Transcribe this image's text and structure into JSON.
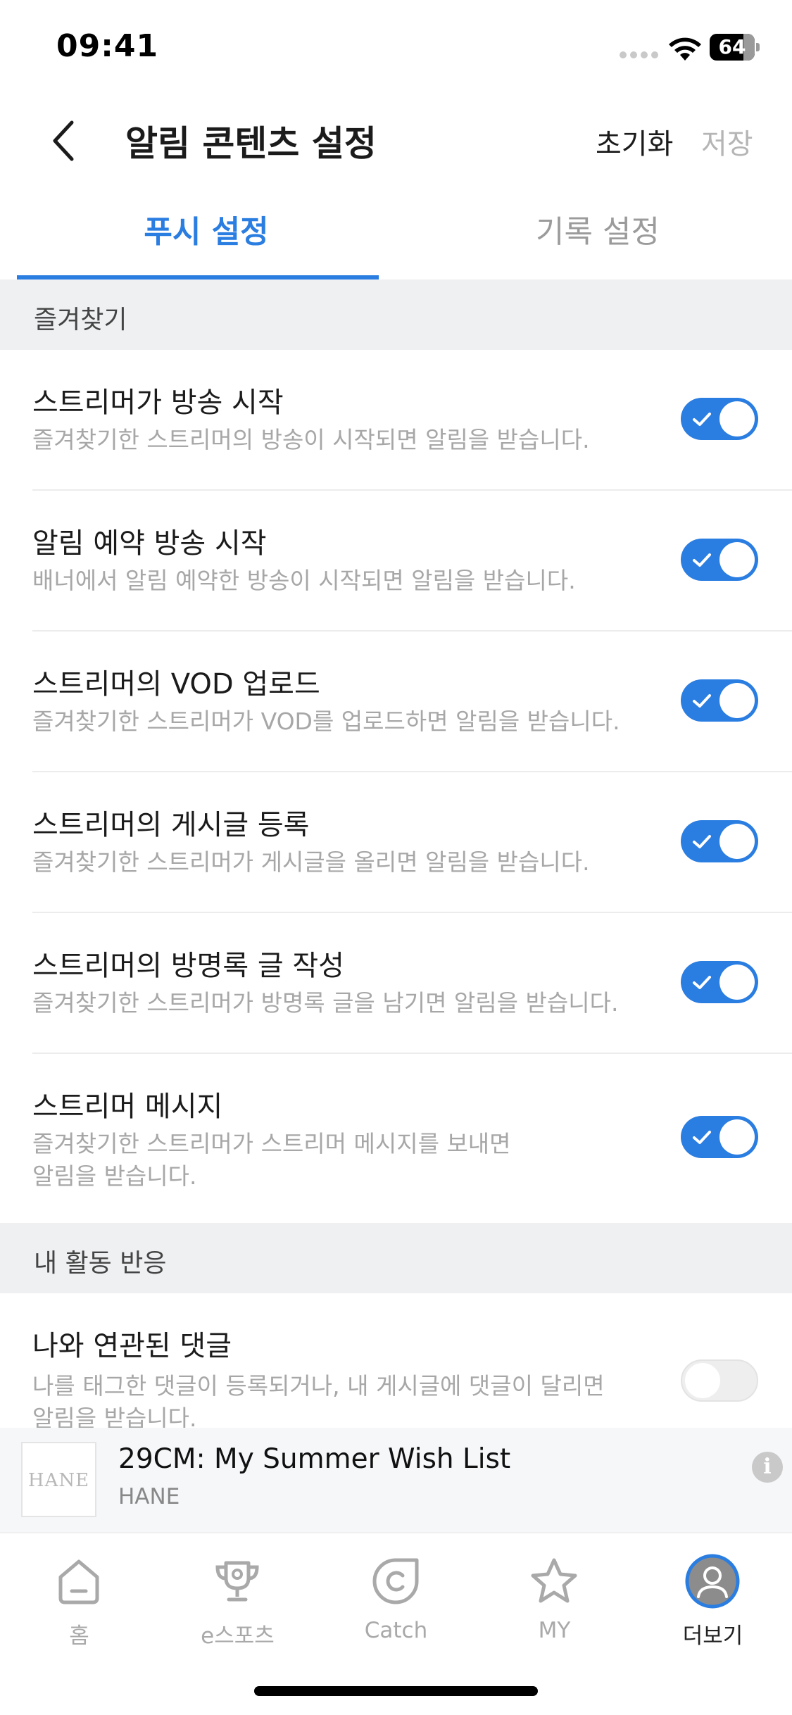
{
  "status_bar": {
    "time": "09:41",
    "battery": "64"
  },
  "header": {
    "title": "알림 콘텐츠 설정",
    "reset_label": "초기화",
    "save_label": "저장"
  },
  "tabs": [
    {
      "label": "푸시 설정",
      "active": true
    },
    {
      "label": "기록 설정",
      "active": false
    }
  ],
  "sections": [
    {
      "label": "즐겨찾기",
      "items": [
        {
          "title": "스트리머가 방송 시작",
          "desc": [
            "즐겨찾기한 스트리머의 방송이 시작되면 알림을 받습니다."
          ],
          "enabled": true
        },
        {
          "title": "알림 예약 방송 시작",
          "desc": [
            "배너에서 알림 예약한 방송이 시작되면 알림을 받습니다."
          ],
          "enabled": true
        },
        {
          "title": "스트리머의 VOD 업로드",
          "desc": [
            "즐겨찾기한 스트리머가 VOD를 업로드하면 알림을 받습니다."
          ],
          "enabled": true
        },
        {
          "title": "스트리머의 게시글 등록",
          "desc": [
            "즐겨찾기한 스트리머가 게시글을 올리면 알림을 받습니다."
          ],
          "enabled": true
        },
        {
          "title": "스트리머의 방명록 글 작성",
          "desc": [
            "즐겨찾기한 스트리머가 방명록 글을 남기면 알림을 받습니다."
          ],
          "enabled": true
        },
        {
          "title": "스트리머 메시지",
          "desc": [
            "즐겨찾기한 스트리머가 스트리머 메시지를 보내면",
            "알림을 받습니다."
          ],
          "enabled": true
        }
      ]
    },
    {
      "label": "내 활동 반응",
      "items": [
        {
          "title": "나와 연관된 댓글",
          "desc": [
            "나를 태그한 댓글이 등록되거나, 내 게시글에 댓글이 달리면",
            "알림을 받습니다."
          ],
          "enabled": false
        }
      ]
    }
  ],
  "ad": {
    "logo_text": "HANE",
    "title": "29CM: My Summer Wish List",
    "subtitle": "HANE",
    "info_icon": "info-icon"
  },
  "bottom_nav": [
    {
      "label": "홈",
      "icon": "home-icon",
      "active": false
    },
    {
      "label": "e스포츠",
      "icon": "trophy-icon",
      "active": false
    },
    {
      "label": "Catch",
      "icon": "catch-icon",
      "active": false
    },
    {
      "label": "MY",
      "icon": "star-icon",
      "active": false
    },
    {
      "label": "더보기",
      "icon": "profile-icon",
      "active": true
    }
  ],
  "colors": {
    "accent": "#2a7de1",
    "section_bg": "#eef0f2",
    "muted_text": "#a7a7a7"
  }
}
